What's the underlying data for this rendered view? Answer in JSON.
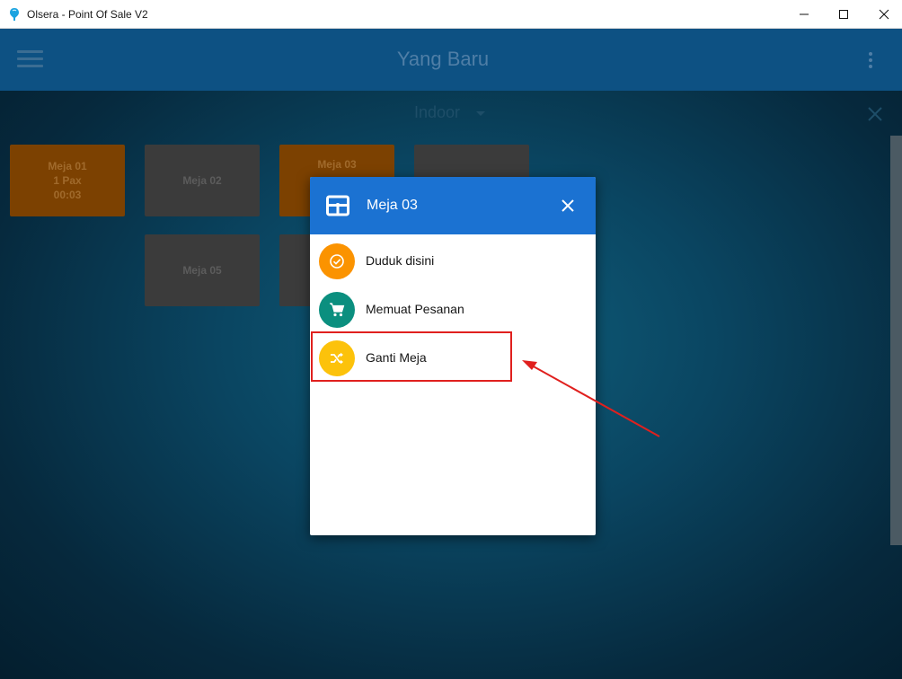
{
  "window": {
    "title": "Olsera - Point Of Sale V2",
    "controls": [
      "minimize",
      "maximize",
      "close"
    ]
  },
  "header": {
    "title": "Yang Baru",
    "menu_icon": "hamburger-menu-icon",
    "more_icon": "more-vert-icon"
  },
  "area": {
    "selected": "Indoor"
  },
  "tables": [
    {
      "name": "Meja 01",
      "pax": "1 Pax",
      "time": "00:03",
      "status": "occupied"
    },
    {
      "name": "Meja 02",
      "status": "free"
    },
    {
      "name": "Meja 03",
      "status": "occupied"
    },
    {
      "name": "",
      "status": "free"
    },
    {
      "name": "Meja 05",
      "status": "free"
    },
    {
      "name": "",
      "status": "free"
    }
  ],
  "dialog": {
    "title": "Meja 03",
    "icon": "table-grid-icon",
    "items": [
      {
        "label": "Duduk disini",
        "icon": "check-circle-icon",
        "color": "#fb9300"
      },
      {
        "label": "Memuat Pesanan",
        "icon": "cart-icon",
        "color": "#0b8f7f"
      },
      {
        "label": "Ganti Meja",
        "icon": "shuffle-icon",
        "color": "#fcc20b"
      }
    ]
  },
  "colors": {
    "header_bg": "#0d5183",
    "dialog_header": "#1b72d2",
    "annotation": "#e0201e",
    "occupied_tile": "#7c4101",
    "free_tile": "#3b3b3b"
  }
}
